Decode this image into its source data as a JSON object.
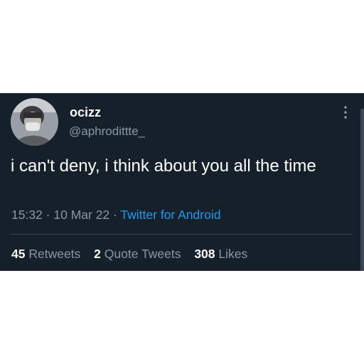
{
  "tweet": {
    "author": {
      "display_name": "ocizz",
      "handle": "@aphrodittte_"
    },
    "text": "i can't deny, i think about you all the time",
    "time": "15:32",
    "separator": "·",
    "date": "10 Mar 22",
    "source": "Twitter for Android",
    "stats": {
      "retweets_count": "45",
      "retweets_label": "Retweets",
      "quotes_count": "2",
      "quotes_label": "Quote Tweets",
      "likes_count": "308",
      "likes_label": "Likes"
    },
    "icons": {
      "avatar": "profile-photo",
      "more": "more-vertical-icon"
    }
  },
  "colors": {
    "background": "#15202b",
    "text_primary": "#ffffff",
    "text_secondary": "#8899a6",
    "link": "#1d9bf0",
    "divider": "#38444d"
  }
}
